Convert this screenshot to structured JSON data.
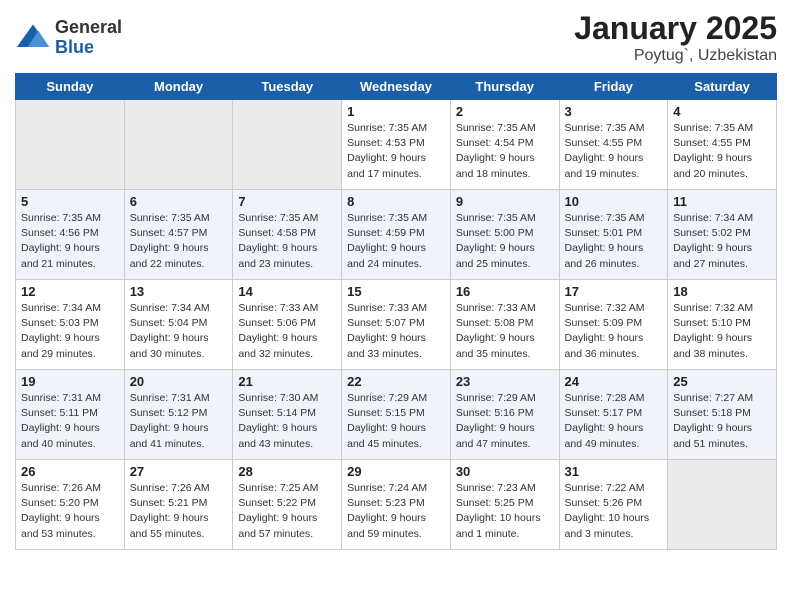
{
  "header": {
    "logo_general": "General",
    "logo_blue": "Blue",
    "title": "January 2025",
    "location": "Poytug`, Uzbekistan"
  },
  "days_of_week": [
    "Sunday",
    "Monday",
    "Tuesday",
    "Wednesday",
    "Thursday",
    "Friday",
    "Saturday"
  ],
  "weeks": [
    [
      {
        "day": "",
        "empty": true
      },
      {
        "day": "",
        "empty": true
      },
      {
        "day": "",
        "empty": true
      },
      {
        "day": "1",
        "sunrise": "7:35 AM",
        "sunset": "4:53 PM",
        "daylight": "9 hours and 17 minutes."
      },
      {
        "day": "2",
        "sunrise": "7:35 AM",
        "sunset": "4:54 PM",
        "daylight": "9 hours and 18 minutes."
      },
      {
        "day": "3",
        "sunrise": "7:35 AM",
        "sunset": "4:55 PM",
        "daylight": "9 hours and 19 minutes."
      },
      {
        "day": "4",
        "sunrise": "7:35 AM",
        "sunset": "4:55 PM",
        "daylight": "9 hours and 20 minutes."
      }
    ],
    [
      {
        "day": "5",
        "sunrise": "7:35 AM",
        "sunset": "4:56 PM",
        "daylight": "9 hours and 21 minutes."
      },
      {
        "day": "6",
        "sunrise": "7:35 AM",
        "sunset": "4:57 PM",
        "daylight": "9 hours and 22 minutes."
      },
      {
        "day": "7",
        "sunrise": "7:35 AM",
        "sunset": "4:58 PM",
        "daylight": "9 hours and 23 minutes."
      },
      {
        "day": "8",
        "sunrise": "7:35 AM",
        "sunset": "4:59 PM",
        "daylight": "9 hours and 24 minutes."
      },
      {
        "day": "9",
        "sunrise": "7:35 AM",
        "sunset": "5:00 PM",
        "daylight": "9 hours and 25 minutes."
      },
      {
        "day": "10",
        "sunrise": "7:35 AM",
        "sunset": "5:01 PM",
        "daylight": "9 hours and 26 minutes."
      },
      {
        "day": "11",
        "sunrise": "7:34 AM",
        "sunset": "5:02 PM",
        "daylight": "9 hours and 27 minutes."
      }
    ],
    [
      {
        "day": "12",
        "sunrise": "7:34 AM",
        "sunset": "5:03 PM",
        "daylight": "9 hours and 29 minutes."
      },
      {
        "day": "13",
        "sunrise": "7:34 AM",
        "sunset": "5:04 PM",
        "daylight": "9 hours and 30 minutes."
      },
      {
        "day": "14",
        "sunrise": "7:33 AM",
        "sunset": "5:06 PM",
        "daylight": "9 hours and 32 minutes."
      },
      {
        "day": "15",
        "sunrise": "7:33 AM",
        "sunset": "5:07 PM",
        "daylight": "9 hours and 33 minutes."
      },
      {
        "day": "16",
        "sunrise": "7:33 AM",
        "sunset": "5:08 PM",
        "daylight": "9 hours and 35 minutes."
      },
      {
        "day": "17",
        "sunrise": "7:32 AM",
        "sunset": "5:09 PM",
        "daylight": "9 hours and 36 minutes."
      },
      {
        "day": "18",
        "sunrise": "7:32 AM",
        "sunset": "5:10 PM",
        "daylight": "9 hours and 38 minutes."
      }
    ],
    [
      {
        "day": "19",
        "sunrise": "7:31 AM",
        "sunset": "5:11 PM",
        "daylight": "9 hours and 40 minutes."
      },
      {
        "day": "20",
        "sunrise": "7:31 AM",
        "sunset": "5:12 PM",
        "daylight": "9 hours and 41 minutes."
      },
      {
        "day": "21",
        "sunrise": "7:30 AM",
        "sunset": "5:14 PM",
        "daylight": "9 hours and 43 minutes."
      },
      {
        "day": "22",
        "sunrise": "7:29 AM",
        "sunset": "5:15 PM",
        "daylight": "9 hours and 45 minutes."
      },
      {
        "day": "23",
        "sunrise": "7:29 AM",
        "sunset": "5:16 PM",
        "daylight": "9 hours and 47 minutes."
      },
      {
        "day": "24",
        "sunrise": "7:28 AM",
        "sunset": "5:17 PM",
        "daylight": "9 hours and 49 minutes."
      },
      {
        "day": "25",
        "sunrise": "7:27 AM",
        "sunset": "5:18 PM",
        "daylight": "9 hours and 51 minutes."
      }
    ],
    [
      {
        "day": "26",
        "sunrise": "7:26 AM",
        "sunset": "5:20 PM",
        "daylight": "9 hours and 53 minutes."
      },
      {
        "day": "27",
        "sunrise": "7:26 AM",
        "sunset": "5:21 PM",
        "daylight": "9 hours and 55 minutes."
      },
      {
        "day": "28",
        "sunrise": "7:25 AM",
        "sunset": "5:22 PM",
        "daylight": "9 hours and 57 minutes."
      },
      {
        "day": "29",
        "sunrise": "7:24 AM",
        "sunset": "5:23 PM",
        "daylight": "9 hours and 59 minutes."
      },
      {
        "day": "30",
        "sunrise": "7:23 AM",
        "sunset": "5:25 PM",
        "daylight": "10 hours and 1 minute."
      },
      {
        "day": "31",
        "sunrise": "7:22 AM",
        "sunset": "5:26 PM",
        "daylight": "10 hours and 3 minutes."
      },
      {
        "day": "",
        "empty": true
      }
    ]
  ]
}
